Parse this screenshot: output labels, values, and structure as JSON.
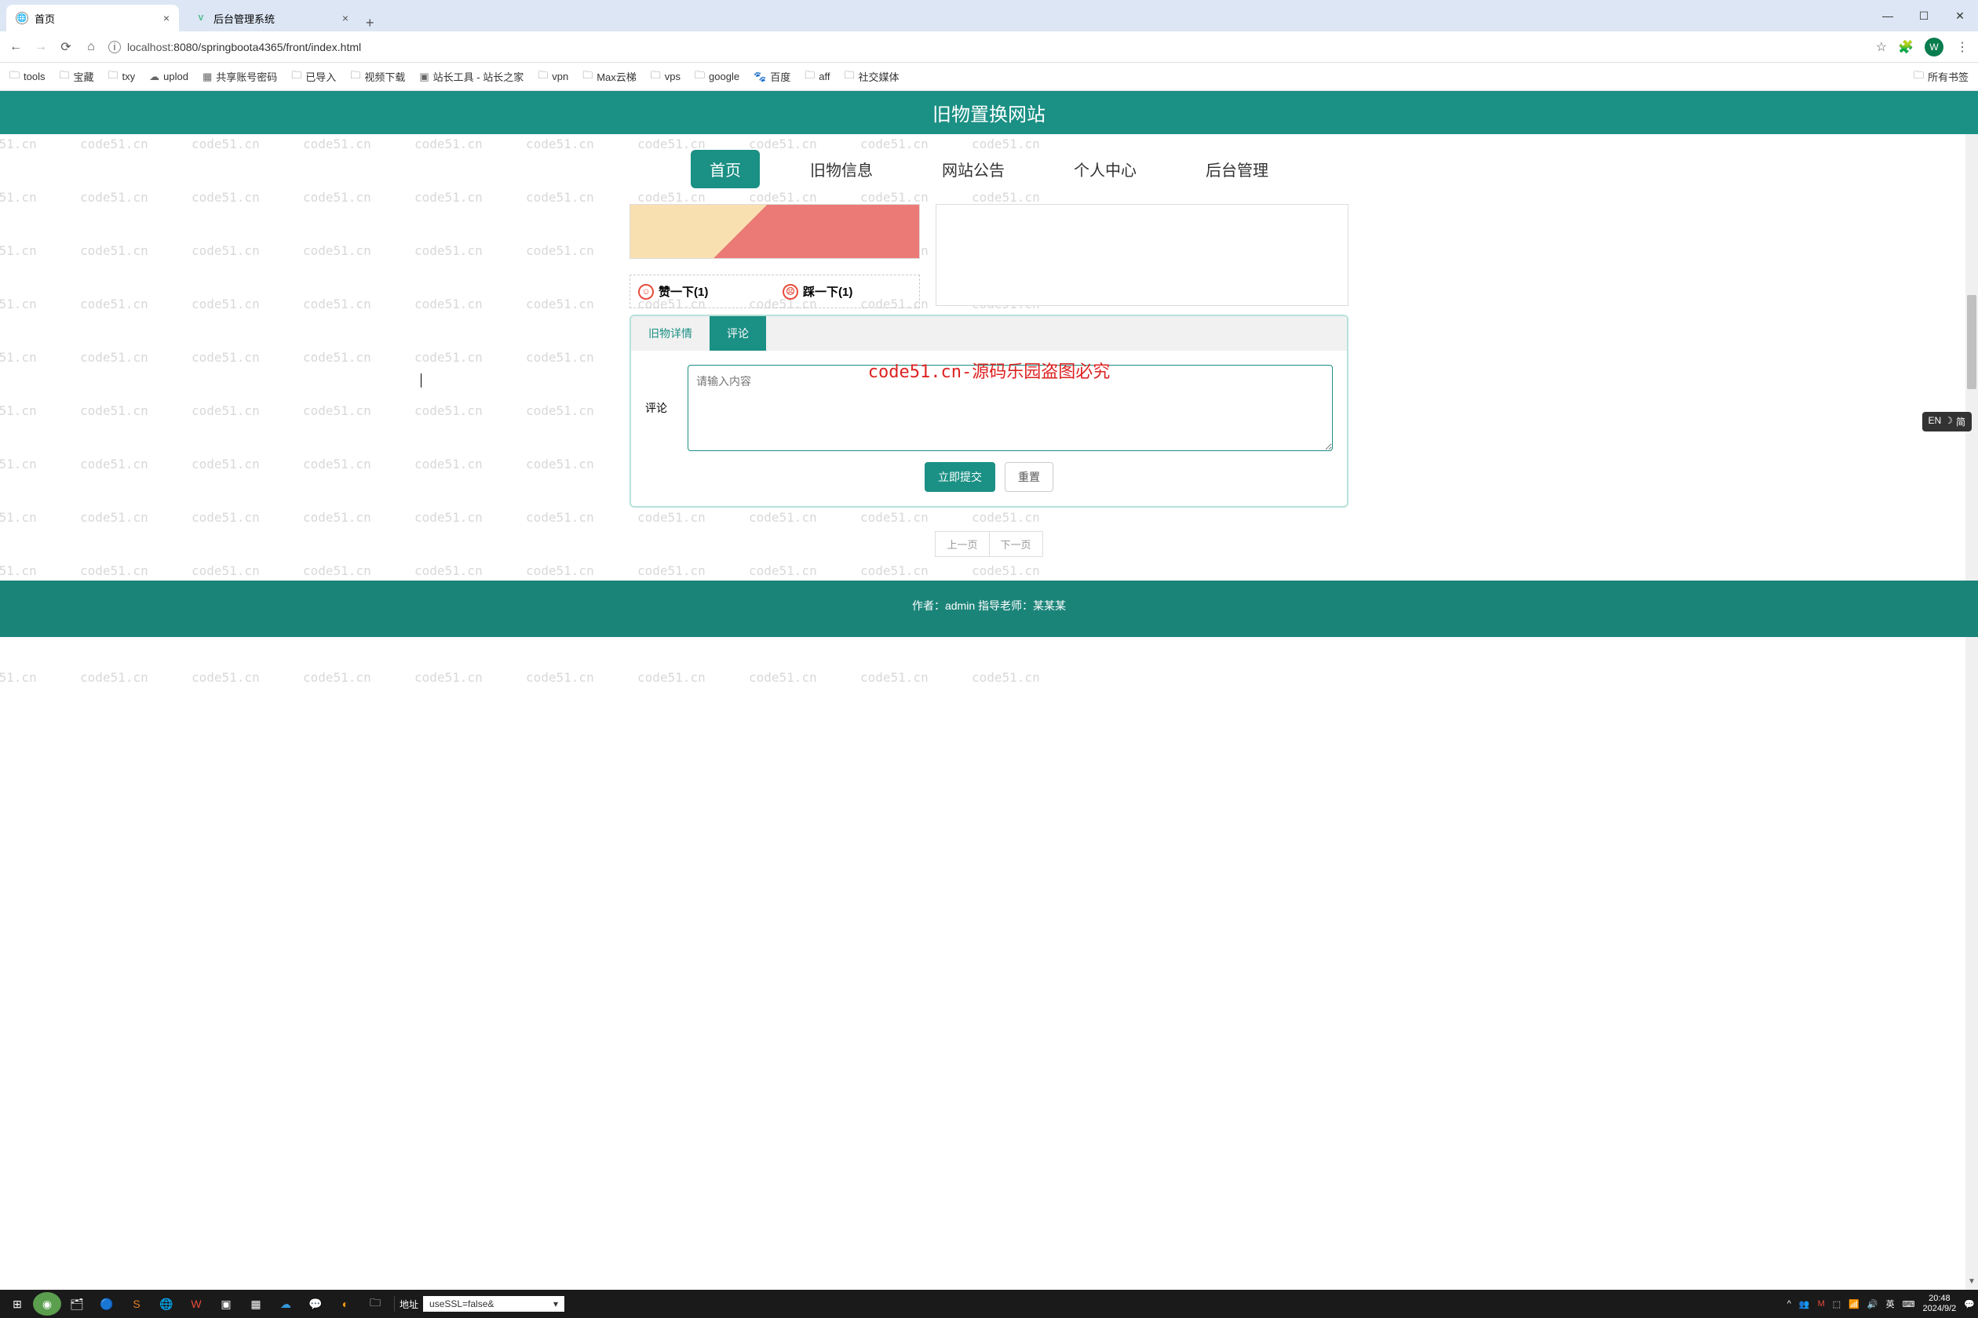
{
  "browser": {
    "tabs": [
      {
        "title": "首页",
        "favicon": "globe"
      },
      {
        "title": "后台管理系统",
        "favicon": "vue"
      }
    ],
    "url_info_icon": "ⓘ",
    "url_host": "localhost:",
    "url_path": "8080/springboota4365/front/index.html",
    "profile_letter": "W"
  },
  "bookmarks": {
    "items": [
      "tools",
      "宝藏",
      "txy",
      "uplod",
      "共享账号密码",
      "已导入",
      "视频下载",
      "站长工具 - 站长之家",
      "vpn",
      "Max云梯",
      "vps",
      "google",
      "百度",
      "aff",
      "社交媒体"
    ],
    "all": "所有书签"
  },
  "site": {
    "title": "旧物置换网站",
    "nav": [
      "首页",
      "旧物信息",
      "网站公告",
      "个人中心",
      "后台管理"
    ]
  },
  "reactions": {
    "like_label": "赞一下(1)",
    "dislike_label": "踩一下(1)"
  },
  "tabs": {
    "detail": "旧物详情",
    "comment": "评论"
  },
  "comment": {
    "label": "评论",
    "placeholder": "请输入内容",
    "submit": "立即提交",
    "reset": "重置"
  },
  "pagination": {
    "prev": "上一页",
    "next": "下一页"
  },
  "footer": {
    "text": "作者：admin 指导老师：某某某"
  },
  "watermark": {
    "text": "code51.cn",
    "big": "code51.cn-源码乐园盗图必究"
  },
  "taskbar": {
    "addr_label": "地址",
    "addr_value": "useSSL=false&",
    "ime_lang": "英",
    "time": "20:48",
    "date": "2024/9/2"
  },
  "ime": {
    "lang": "EN",
    "mode": "简"
  }
}
